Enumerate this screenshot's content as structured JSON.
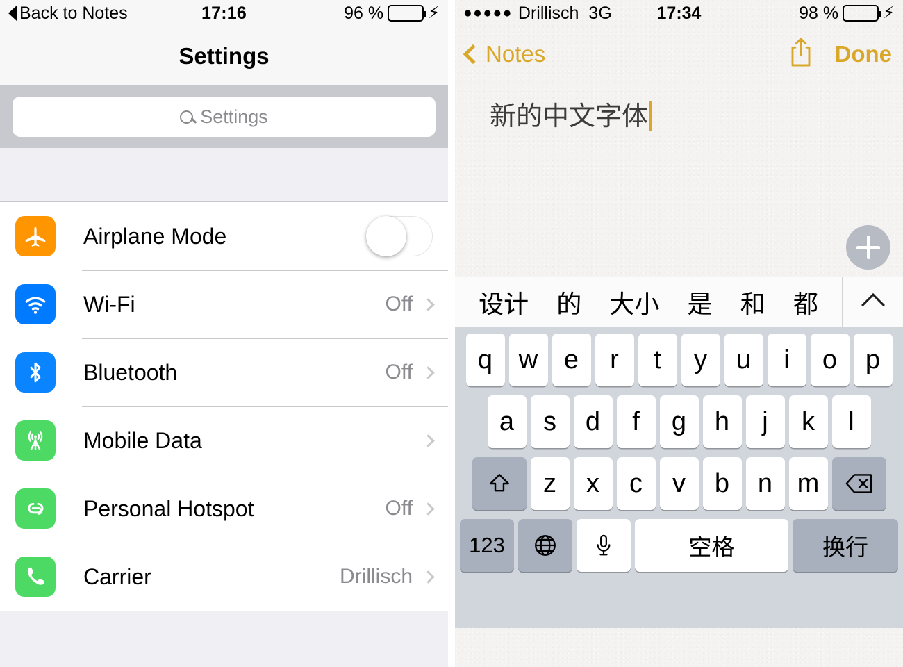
{
  "left": {
    "status_bar": {
      "back_label": "Back to Notes",
      "time": "17:16",
      "battery_percent": "96 %",
      "battery_color": "#4cd964",
      "charging_icon": "lightning-bolt-icon"
    },
    "nav": {
      "title": "Settings"
    },
    "search": {
      "placeholder": "Settings",
      "icon": "search-icon"
    },
    "rows": [
      {
        "label": "Airplane Mode",
        "icon": "airplane-icon",
        "icon_color": "#ff9500",
        "control": "toggle",
        "toggle_on": false,
        "value": ""
      },
      {
        "label": "Wi-Fi",
        "icon": "wifi-icon",
        "icon_color": "#007aff",
        "control": "disclosure",
        "value": "Off"
      },
      {
        "label": "Bluetooth",
        "icon": "bluetooth-icon",
        "icon_color": "#0a84ff",
        "control": "disclosure",
        "value": "Off"
      },
      {
        "label": "Mobile Data",
        "icon": "cellular-antenna-icon",
        "icon_color": "#4cd964",
        "control": "disclosure",
        "value": ""
      },
      {
        "label": "Personal Hotspot",
        "icon": "hotspot-link-icon",
        "icon_color": "#4cd964",
        "control": "disclosure",
        "value": "Off"
      },
      {
        "label": "Carrier",
        "icon": "phone-handset-icon",
        "icon_color": "#4cd964",
        "control": "disclosure",
        "value": "Drillisch"
      }
    ]
  },
  "right": {
    "status_bar": {
      "signal_dots": "●●●●●",
      "carrier": "Drillisch",
      "network": "3G",
      "time": "17:34",
      "battery_percent": "98 %",
      "battery_color": "#ffcc00",
      "charging_icon": "lightning-bolt-icon"
    },
    "nav": {
      "back_label": "Notes",
      "share_icon": "share-upload-icon",
      "done_label": "Done",
      "accent_color": "#d9a82b"
    },
    "note": {
      "text": "新的中文字体",
      "add_button_icon": "plus-icon"
    },
    "candidates": {
      "items": [
        "设计",
        "的",
        "大小",
        "是",
        "和",
        "都"
      ],
      "expand_icon": "chevron-up-icon"
    },
    "keyboard": {
      "row1": [
        "q",
        "w",
        "e",
        "r",
        "t",
        "y",
        "u",
        "i",
        "o",
        "p"
      ],
      "row2": [
        "a",
        "s",
        "d",
        "f",
        "g",
        "h",
        "j",
        "k",
        "l"
      ],
      "row3": [
        "z",
        "x",
        "c",
        "v",
        "b",
        "n",
        "m"
      ],
      "shift_icon": "shift-arrow-icon",
      "delete_icon": "backspace-delete-icon",
      "numbers_label": "123",
      "globe_icon": "globe-language-icon",
      "mic_icon": "microphone-icon",
      "space_label": "空格",
      "enter_label": "换行"
    }
  }
}
